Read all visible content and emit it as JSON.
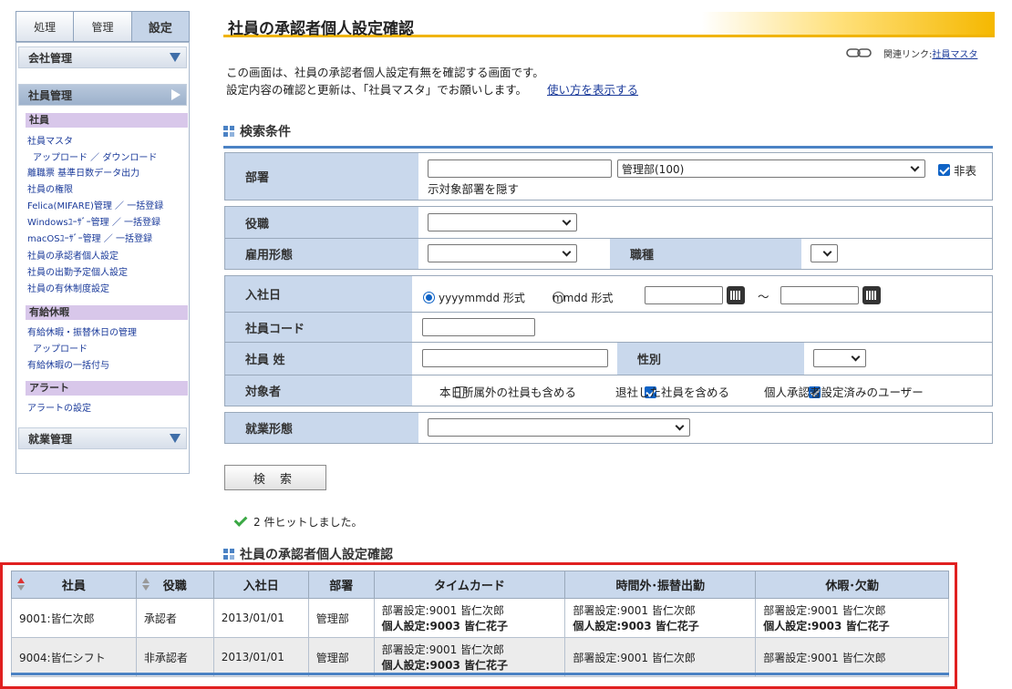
{
  "tabs": [
    "処理",
    "管理",
    "設定"
  ],
  "sidebar": {
    "company": "会社管理",
    "employee": "社員管理",
    "cat_employee": "社員",
    "links": [
      "社員マスタ",
      "アップロード ／ ダウンロード",
      "離職票 基準日数データ出力",
      "社員の権限",
      "Felica(MIFARE)管理 ／ 一括登録",
      "Windowsﾕｰｻﾞｰ管理 ／ 一括登録",
      "macOSﾕｰｻﾞｰ管理 ／ 一括登録",
      "社員の承認者個人設定",
      "社員の出勤予定個人設定",
      "社員の有休制度設定"
    ],
    "cat_leave": "有給休暇",
    "leave_links": [
      "有給休暇・振替休日の管理",
      "アップロード",
      "有給休暇の一括付与"
    ],
    "cat_alert": "アラート",
    "alert_links": [
      "アラートの設定"
    ],
    "work": "就業管理"
  },
  "page": {
    "title": "社員の承認者個人設定確認",
    "related_label": "関連リンク:",
    "related_link": "社員マスタ",
    "desc1": "この画面は、社員の承認者個人設定有無を確認する画面です。",
    "desc2": "設定内容の確認と更新は、「社員マスタ」でお願いします。",
    "howto": "使い方を表示する"
  },
  "search": {
    "title": "検索条件",
    "dept_label": "部署",
    "dept_text": "",
    "dept_select": "管理部(100)",
    "hide_label_a": "非表",
    "hide_label_b": "示対象部署を隠す",
    "post_label": "役職",
    "emp_type_label": "雇用形態",
    "job_label": "職種",
    "join_label": "入社日",
    "fmt1": "yyyymmdd 形式",
    "fmt2": "mmdd 形式",
    "tilde": "～",
    "code_label": "社員コード",
    "name_label": "社員 姓",
    "gender_label": "性別",
    "target_label": "対象者",
    "opt1": "本日所属外の社員も含める",
    "opt2": "退社した社員を含める",
    "opt3": "個人承認者設定済みのユーザー",
    "work_label": "就業形態",
    "button": "検 索"
  },
  "hit_text": "2 件ヒットしました。",
  "result": {
    "title": "社員の承認者個人設定確認",
    "headers": [
      "社員",
      "役職",
      "入社日",
      "部署",
      "タイムカード",
      "時間外･振替出勤",
      "休暇･欠勤"
    ],
    "rows": [
      {
        "emp": "9001:皆仁次郎",
        "post": "承認者",
        "date": "2013/01/01",
        "dept": "管理部",
        "tc1": "部署設定:9001 皆仁次郎",
        "tc2": "個人設定:9003 皆仁花子",
        "ot1": "部署設定:9001 皆仁次郎",
        "ot2": "個人設定:9003 皆仁花子",
        "lv1": "部署設定:9001 皆仁次郎",
        "lv2": "個人設定:9003 皆仁花子"
      },
      {
        "emp": "9004:皆仁シフト",
        "post": "非承認者",
        "date": "2013/01/01",
        "dept": "管理部",
        "tc1": "部署設定:9001 皆仁次郎",
        "tc2": "個人設定:9003 皆仁花子",
        "ot1": "部署設定:9001 皆仁次郎",
        "ot2": "",
        "lv1": "部署設定:9001 皆仁次郎",
        "lv2": ""
      }
    ]
  },
  "colors": {
    "accent": "#4b82c4",
    "label_bg": "#c9d8ec",
    "highlight": "#e02020"
  }
}
